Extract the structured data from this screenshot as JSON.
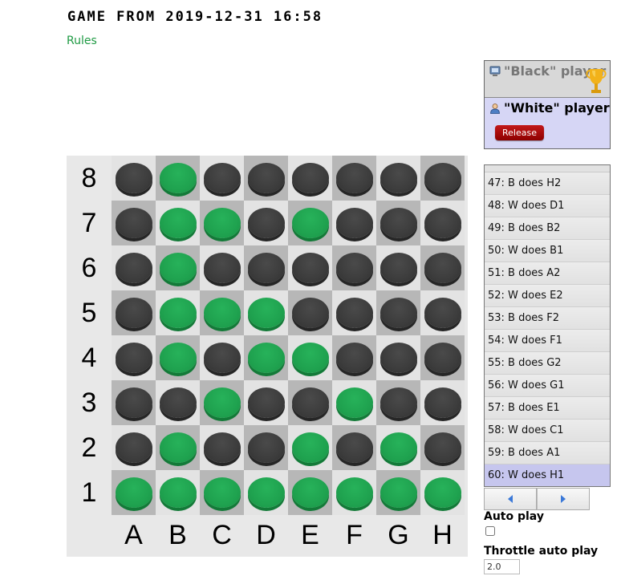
{
  "page": {
    "title": "GAME FROM 2019-12-31 16:58",
    "rules_link": "Rules"
  },
  "board": {
    "ranks": [
      "8",
      "7",
      "6",
      "5",
      "4",
      "3",
      "2",
      "1"
    ],
    "files": [
      "A",
      "B",
      "C",
      "D",
      "E",
      "F",
      "G",
      "H"
    ],
    "rows": [
      [
        "black",
        "green",
        "black",
        "black",
        "black",
        "black",
        "black",
        "black"
      ],
      [
        "black",
        "green",
        "green",
        "black",
        "green",
        "black",
        "black",
        "black"
      ],
      [
        "black",
        "green",
        "black",
        "black",
        "black",
        "black",
        "black",
        "black"
      ],
      [
        "black",
        "green",
        "green",
        "green",
        "black",
        "black",
        "black",
        "black"
      ],
      [
        "black",
        "green",
        "black",
        "green",
        "green",
        "black",
        "black",
        "black"
      ],
      [
        "black",
        "black",
        "green",
        "black",
        "black",
        "green",
        "black",
        "black"
      ],
      [
        "black",
        "green",
        "black",
        "black",
        "green",
        "black",
        "green",
        "black"
      ],
      [
        "green",
        "green",
        "green",
        "green",
        "green",
        "green",
        "green",
        "green"
      ]
    ],
    "colors": {
      "black_disc": "#3c3c3c",
      "green_disc": "#1fa24f",
      "light_square": "#e3e3e3",
      "dark_square": "#b7b7b7"
    }
  },
  "players": {
    "black": {
      "name": "\"Black\" player",
      "icon": "computer-icon",
      "badge": "trophy-icon"
    },
    "white": {
      "name": "\"White\" player",
      "icon": "person-icon"
    },
    "release_label": "Release"
  },
  "moves": {
    "items": [
      "47: B does H2",
      "48: W does D1",
      "49: B does B2",
      "50: W does B1",
      "51: B does A2",
      "52: W does E2",
      "53: B does F2",
      "54: W does F1",
      "55: B does G2",
      "56: W does G1",
      "57: B does E1",
      "58: W does C1",
      "59: B does A1",
      "60: W does H1"
    ],
    "current_index": 13
  },
  "controls": {
    "prev_icon": "triangle-left-icon",
    "next_icon": "triangle-right-icon",
    "auto_play_label": "Auto play",
    "auto_play_checked": false,
    "throttle_label": "Throttle auto play",
    "throttle_value": "2.0"
  }
}
